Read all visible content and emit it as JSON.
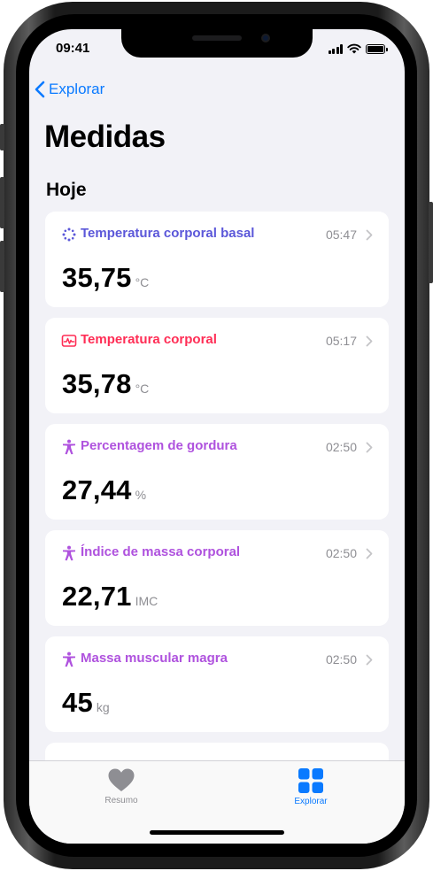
{
  "status_bar": {
    "time": "09:41"
  },
  "nav": {
    "back_label": "Explorar",
    "title": "Medidas"
  },
  "section": {
    "header": "Hoje"
  },
  "colors": {
    "accent": "#0a7aff",
    "basal_temp": "#5b57d9",
    "body_temp": "#ff2d55",
    "body_measurements": "#af52de",
    "tab_inactive": "#8e8e93"
  },
  "measurements": [
    {
      "title": "Temperatura corporal basal",
      "time": "05:47",
      "value": "35,75",
      "unit": "°C",
      "icon": "sparkle-circle-icon"
    },
    {
      "title": "Temperatura corporal",
      "time": "05:17",
      "value": "35,78",
      "unit": "°C",
      "icon": "waveform-icon"
    },
    {
      "title": "Percentagem de gordura",
      "time": "02:50",
      "value": "27,44",
      "unit": "%",
      "icon": "figure-icon"
    },
    {
      "title": "Índice de massa corporal",
      "time": "02:50",
      "value": "22,71",
      "unit": "IMC",
      "icon": "figure-icon"
    },
    {
      "title": "Massa muscular magra",
      "time": "02:50",
      "value": "45",
      "unit": "kg",
      "icon": "figure-icon"
    }
  ],
  "tabbar": {
    "tabs": [
      {
        "label": "Resumo",
        "icon": "heart-icon",
        "selected": false
      },
      {
        "label": "Explorar",
        "icon": "grid-icon",
        "selected": true
      }
    ]
  }
}
